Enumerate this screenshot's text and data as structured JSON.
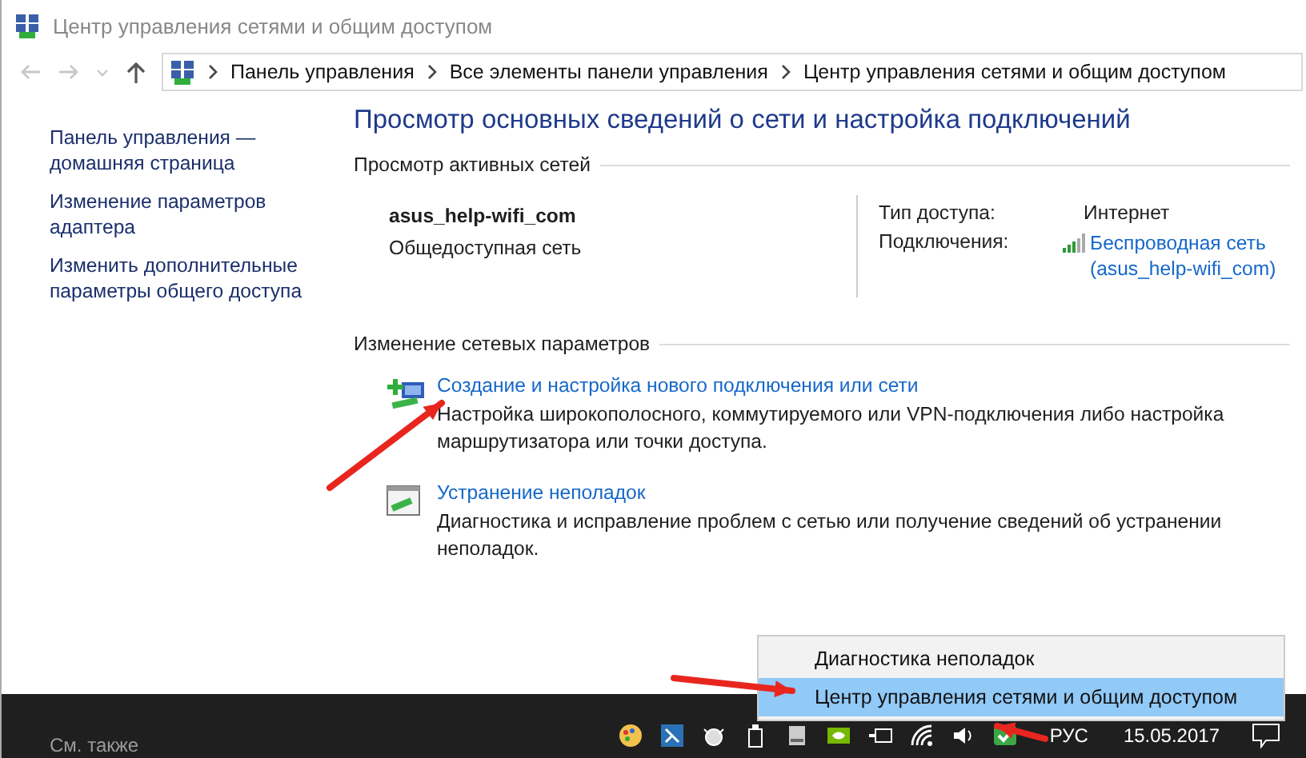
{
  "window": {
    "title": "Центр управления сетями и общим доступом"
  },
  "address_bar": {
    "breadcrumbs": [
      "Панель управления",
      "Все элементы панели управления",
      "Центр управления сетями и общим доступом"
    ]
  },
  "sidebar": {
    "links": [
      "Панель управления — домашняя страница",
      "Изменение параметров адаптера",
      "Изменить дополнительные параметры общего доступа"
    ],
    "see_also": "См. также"
  },
  "main": {
    "heading": "Просмотр основных сведений о сети и настройка подключений",
    "active_networks": {
      "header": "Просмотр активных сетей",
      "network_name": "asus_help-wifi_com",
      "network_type": "Общедоступная сеть",
      "details": [
        {
          "label": "Тип доступа:",
          "value": "Интернет",
          "kind": "text"
        },
        {
          "label": "Подключения:",
          "value": "Беспроводная сеть (asus_help-wifi_com)",
          "kind": "link"
        }
      ]
    },
    "settings": {
      "header": "Изменение сетевых параметров",
      "tasks": [
        {
          "kind": "new-connection",
          "title": "Создание и настройка нового подключения или сети",
          "description": "Настройка широкополосного, коммутируемого или VPN-подключения либо настройка маршрутизатора или точки доступа."
        },
        {
          "kind": "troubleshoot",
          "title": "Устранение неполадок",
          "description": "Диагностика и исправление проблем с сетью или получение сведений об устранении неполадок."
        }
      ]
    }
  },
  "context_menu": {
    "items": [
      {
        "label": "Диагностика неполадок",
        "selected": false
      },
      {
        "label": "Центр управления сетями и общим доступом",
        "selected": true
      }
    ]
  },
  "taskbar": {
    "language": "РУС",
    "date": "15.05.2017"
  }
}
